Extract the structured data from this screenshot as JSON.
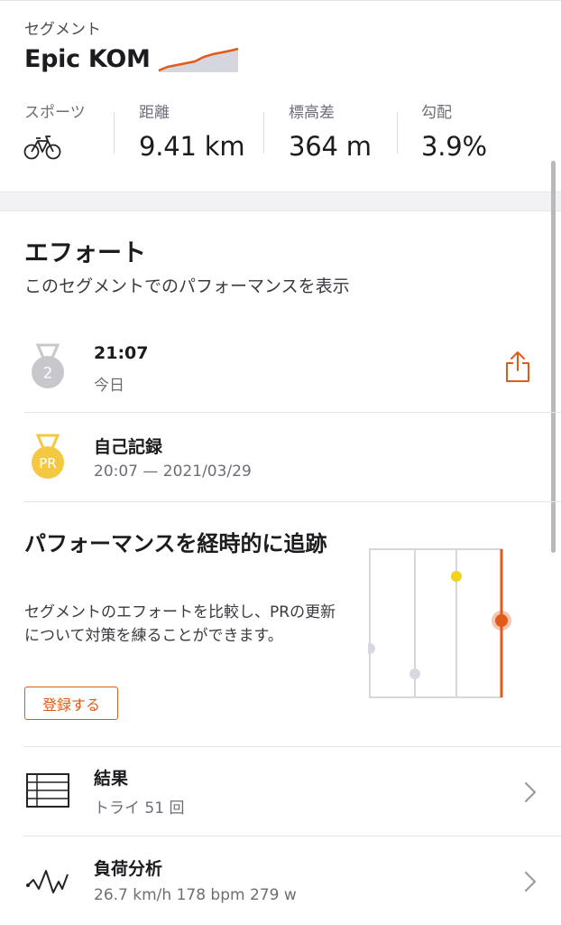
{
  "segment": {
    "label": "セグメント",
    "title": "Epic KOM",
    "stats": [
      {
        "label": "スポーツ",
        "value": ""
      },
      {
        "label": "距離",
        "value": "9.41 km"
      },
      {
        "label": "標高差",
        "value": "364 m"
      },
      {
        "label": "勾配",
        "value": "3.9%"
      }
    ]
  },
  "efforts": {
    "title": "エフォート",
    "subtitle": "このセグメントでのパフォーマンスを表示",
    "items": [
      {
        "medal": "2",
        "time": "21:07",
        "date": "今日"
      },
      {
        "medal": "PR",
        "time": "自己記録",
        "date": "20:07 — 2021/03/29"
      }
    ]
  },
  "performance": {
    "title": "パフォーマンスを経時的に追跡",
    "body": "セグメントのエフォートを比較し、PRの更新について対策を練ることができます。",
    "button": "登録する"
  },
  "list": [
    {
      "title": "結果",
      "sub": "トライ 51 回",
      "icon": "table-icon"
    },
    {
      "title": "負荷分析",
      "sub": "26.7 km/h 178 bpm 279 w",
      "icon": "analysis-wave-icon"
    }
  ],
  "colors": {
    "accent": "#e05a1a",
    "gold": "#f5c842",
    "silver": "#c8c8cc"
  }
}
